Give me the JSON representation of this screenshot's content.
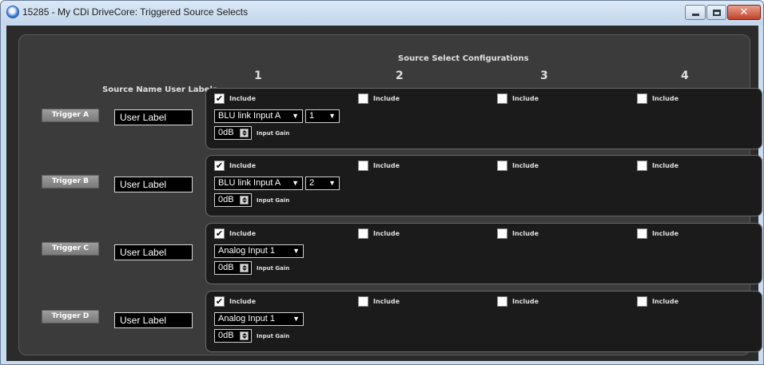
{
  "window": {
    "title": "15285 - My CDi DriveCore: Triggered Source Selects",
    "controls": {
      "minimize": "minimize",
      "maximize": "maximize",
      "close": "✕"
    }
  },
  "header": {
    "config_title": "Source Select Configurations",
    "columns": [
      "1",
      "2",
      "3",
      "4"
    ],
    "source_label": "Source Name User Labels"
  },
  "triggers": [
    {
      "name": "Trigger A",
      "user_label": "User Label",
      "includes": [
        {
          "label": "Include",
          "checked": true
        },
        {
          "label": "Include",
          "checked": false
        },
        {
          "label": "Include",
          "checked": false
        },
        {
          "label": "Include",
          "checked": false
        }
      ],
      "source": "BLU link Input A",
      "channel": "1",
      "gain": "0dB",
      "gain_label": "Input Gain"
    },
    {
      "name": "Trigger B",
      "user_label": "User Label",
      "includes": [
        {
          "label": "Include",
          "checked": true
        },
        {
          "label": "Include",
          "checked": false
        },
        {
          "label": "Include",
          "checked": false
        },
        {
          "label": "Include",
          "checked": false
        }
      ],
      "source": "BLU link Input A",
      "channel": "2",
      "gain": "0dB",
      "gain_label": "Input Gain"
    },
    {
      "name": "Trigger C",
      "user_label": "User Label",
      "includes": [
        {
          "label": "Include",
          "checked": true
        },
        {
          "label": "Include",
          "checked": false
        },
        {
          "label": "Include",
          "checked": false
        },
        {
          "label": "Include",
          "checked": false
        }
      ],
      "source": "Analog Input 1",
      "gain": "0dB",
      "gain_label": "Input Gain"
    },
    {
      "name": "Trigger D",
      "user_label": "User Label",
      "includes": [
        {
          "label": "Include",
          "checked": true
        },
        {
          "label": "Include",
          "checked": false
        },
        {
          "label": "Include",
          "checked": false
        },
        {
          "label": "Include",
          "checked": false
        }
      ],
      "source": "Analog Input 1",
      "gain": "0dB",
      "gain_label": "Input Gain"
    }
  ],
  "icons": {
    "app": "app-icon",
    "dropdown": "chevron-down-icon",
    "spinner": "spinner-icon",
    "check": "✔"
  },
  "colors": {
    "background": "#2b2b2b",
    "panel": "#3b3b3b",
    "trigger_panel": "#1b1b1b",
    "trigger_button": "#8a8a8a",
    "text": "#e0e0e0",
    "titlebar": "#c3d6ec",
    "close_button": "#c2432a"
  }
}
